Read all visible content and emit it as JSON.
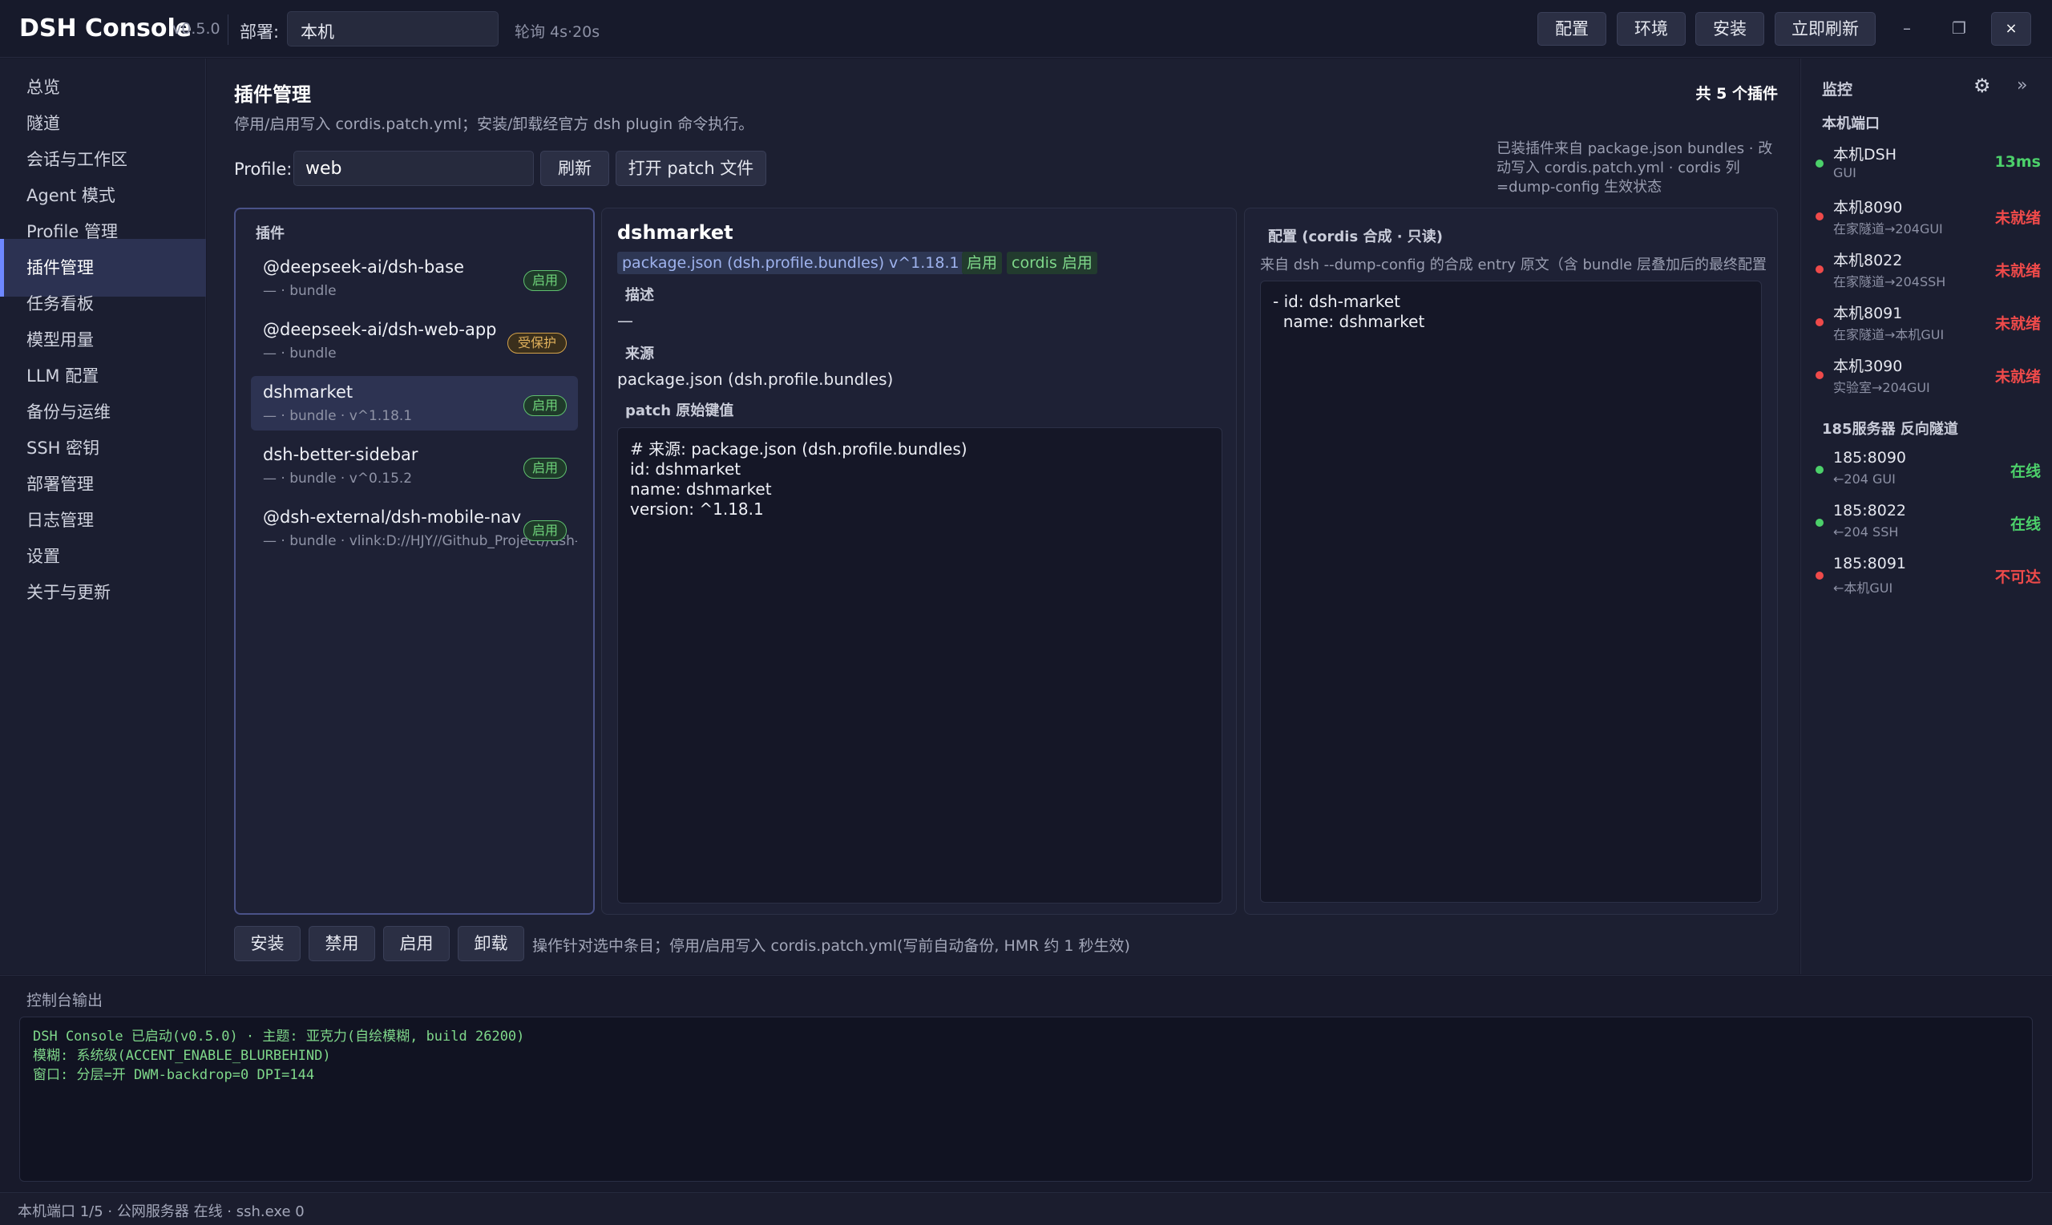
{
  "titlebar": {
    "app_title": "DSH Console",
    "version": "v0.5.0",
    "deploy_label": "部署:",
    "deploy_value": "本机",
    "poll_text": "轮询 4s·20s",
    "buttons": {
      "config": "配置",
      "env": "环境",
      "install": "安装",
      "refresh_now": "立即刷新"
    },
    "window_controls": {
      "minimize": "–",
      "maximize": "❐",
      "close": "×"
    }
  },
  "sidebar": {
    "items": [
      {
        "label": "总览",
        "active": false
      },
      {
        "label": "隧道",
        "active": false
      },
      {
        "label": "会话与工作区",
        "active": false
      },
      {
        "label": "Agent 模式",
        "active": false
      },
      {
        "label": "Profile 管理",
        "active": false
      },
      {
        "label": "插件管理",
        "active": true
      },
      {
        "label": "任务看板",
        "active": false
      },
      {
        "label": "模型用量",
        "active": false
      },
      {
        "label": "LLM 配置",
        "active": false
      },
      {
        "label": "备份与运维",
        "active": false
      },
      {
        "label": "SSH 密钥",
        "active": false
      },
      {
        "label": "部署管理",
        "active": false
      },
      {
        "label": "日志管理",
        "active": false
      },
      {
        "label": "设置",
        "active": false
      },
      {
        "label": "关于与更新",
        "active": false
      }
    ]
  },
  "main": {
    "title": "插件管理",
    "subtitle": "停用/启用写入 cordis.patch.yml；安装/卸载经官方 dsh plugin 命令执行。",
    "plugin_count": "共 5 个插件",
    "profile_label": "Profile:",
    "profile_value": "web",
    "refresh_button": "刷新",
    "open_patch_button": "打开 patch 文件",
    "info_note": "已装插件来自 package.json bundles · 改动写入 cordis.patch.yml · cordis 列=dump-config 生效状态",
    "plugin_list": {
      "title": "插件",
      "items": [
        {
          "name": "@deepseek-ai/dsh-base",
          "sub": "— · bundle",
          "badge": "启用",
          "badge_type": "ok"
        },
        {
          "name": "@deepseek-ai/dsh-web-app",
          "sub": "— · bundle",
          "badge": "受保护",
          "badge_type": "warn"
        },
        {
          "name": "dshmarket",
          "sub": "— · bundle · v^1.18.1",
          "badge": "启用",
          "badge_type": "ok"
        },
        {
          "name": "dsh-better-sidebar",
          "sub": "— · bundle · v^0.15.2",
          "badge": "启用",
          "badge_type": "ok"
        },
        {
          "name": "@dsh-external/dsh-mobile-nav",
          "sub": "— · bundle · vlink:D://HJY//Github_Project//dsh-web",
          "badge": "启用",
          "badge_type": "ok"
        }
      ]
    },
    "detail": {
      "title": "dshmarket",
      "tags": {
        "source": "package.json (dsh.profile.bundles)",
        "version": "v^1.18.1",
        "enabled": "启用",
        "cordis": "cordis 启用"
      },
      "desc_label": "描述",
      "desc_value": "—",
      "source_label": "来源",
      "source_value": "package.json (dsh.profile.bundles)",
      "patch_label": "patch 原始键值",
      "patch_lines": [
        "# 来源: package.json (dsh.profile.bundles)",
        "id: dshmarket",
        "name: dshmarket",
        "version: ^1.18.1"
      ]
    },
    "config": {
      "title": "配置 (cordis 合成 · 只读)",
      "desc": "来自 dsh --dump-config 的合成 entry 原文（含 bundle 层叠加后的最终配置",
      "lines": [
        "- id: dsh-market",
        "  name: dshmarket"
      ]
    },
    "actions": {
      "install": "安装",
      "disable": "禁用",
      "enable": "启用",
      "uninstall": "卸载",
      "hint": "操作针对选中条目；停用/启用写入 cordis.patch.yml(写前自动备份, HMR 约 1 秒生效)"
    }
  },
  "monitor": {
    "title": "监控",
    "gear_icon": "⚙",
    "collapse_icon": "»",
    "local_section": "本机端口",
    "local_items": [
      {
        "name": "本机DSH",
        "sub": "GUI",
        "status": "13ms",
        "state": "green"
      },
      {
        "name": "本机8090",
        "sub": "在家隧道→204GUI",
        "status": "未就绪",
        "state": "red"
      },
      {
        "name": "本机8022",
        "sub": "在家隧道→204SSH",
        "status": "未就绪",
        "state": "red"
      },
      {
        "name": "本机8091",
        "sub": "在家隧道→本机GUI",
        "status": "未就绪",
        "state": "red"
      },
      {
        "name": "本机3090",
        "sub": "实验室→204GUI",
        "status": "未就绪",
        "state": "red"
      }
    ],
    "remote_section": "185服务器 反向隧道",
    "remote_items": [
      {
        "name": "185:8090",
        "sub": "←204 GUI",
        "status": "在线",
        "state": "green"
      },
      {
        "name": "185:8022",
        "sub": "←204 SSH",
        "status": "在线",
        "state": "green"
      },
      {
        "name": "185:8091",
        "sub": "←本机GUI",
        "status": "不可达",
        "state": "red"
      }
    ]
  },
  "console": {
    "title": "控制台输出",
    "lines": [
      "DSH Console 已启动(v0.5.0) · 主题: 亚克力(自绘模糊, build 26200)",
      "模糊: 系统级(ACCENT_ENABLE_BLURBEHIND)",
      "窗口: 分层=开 DWM-backdrop=0 DPI=144"
    ]
  },
  "statusbar": {
    "text": "本机端口 1/5 · 公网服务器 在线 · ssh.exe 0"
  }
}
